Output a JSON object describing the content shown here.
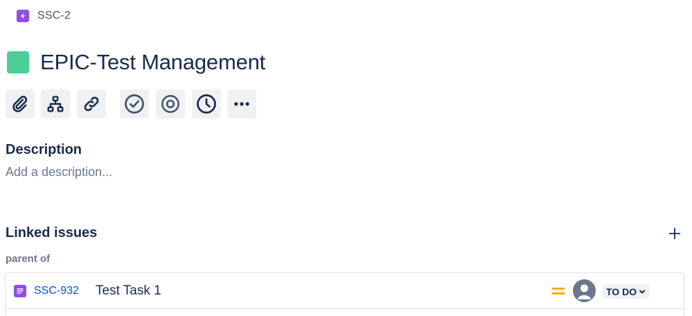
{
  "breadcrumb": {
    "icon": "lightning-bolt-icon",
    "key": "SSC-2"
  },
  "issue": {
    "title": "EPIC-Test Management",
    "color": "#4bce97"
  },
  "toolbar": {
    "buttons": [
      {
        "icon": "paperclip-icon"
      },
      {
        "icon": "child-issues-icon"
      },
      {
        "icon": "link-icon"
      },
      {
        "icon": "check-circle-icon"
      },
      {
        "icon": "target-icon"
      },
      {
        "icon": "clock-icon"
      },
      {
        "icon": "more-icon"
      }
    ]
  },
  "description": {
    "heading": "Description",
    "placeholder": "Add a description..."
  },
  "linked_issues": {
    "heading": "Linked issues",
    "add_icon": "plus-icon",
    "group_label": "parent of",
    "items": [
      {
        "type_icon": "task-icon",
        "key": "SSC-932",
        "summary": "Test Task 1",
        "priority_icon": "priority-medium-icon",
        "avatar_icon": "default-avatar-icon",
        "status": "TO DO",
        "status_icon": "chevron-down-icon"
      }
    ]
  },
  "colors": {
    "accent": "#0052cc",
    "epic": "#904ee2",
    "priority_medium": "#ffab00",
    "text": "#172b4d"
  }
}
